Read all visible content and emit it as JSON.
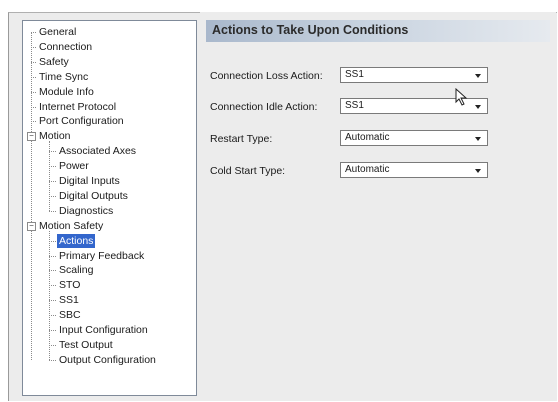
{
  "tree": {
    "items": [
      {
        "label": "General",
        "level": 0,
        "selected": false
      },
      {
        "label": "Connection",
        "level": 0,
        "selected": false
      },
      {
        "label": "Safety",
        "level": 0,
        "selected": false
      },
      {
        "label": "Time Sync",
        "level": 0,
        "selected": false
      },
      {
        "label": "Module Info",
        "level": 0,
        "selected": false
      },
      {
        "label": "Internet Protocol",
        "level": 0,
        "selected": false
      },
      {
        "label": "Port Configuration",
        "level": 0,
        "selected": false
      },
      {
        "label": "Motion",
        "level": 0,
        "selected": false,
        "expander": "−"
      },
      {
        "label": "Associated Axes",
        "level": 1,
        "selected": false
      },
      {
        "label": "Power",
        "level": 1,
        "selected": false
      },
      {
        "label": "Digital Inputs",
        "level": 1,
        "selected": false
      },
      {
        "label": "Digital Outputs",
        "level": 1,
        "selected": false
      },
      {
        "label": "Diagnostics",
        "level": 1,
        "selected": false
      },
      {
        "label": "Motion Safety",
        "level": 0,
        "selected": false,
        "expander": "−"
      },
      {
        "label": "Actions",
        "level": 1,
        "selected": true
      },
      {
        "label": "Primary Feedback",
        "level": 1,
        "selected": false
      },
      {
        "label": "Scaling",
        "level": 1,
        "selected": false
      },
      {
        "label": "STO",
        "level": 1,
        "selected": false
      },
      {
        "label": "SS1",
        "level": 1,
        "selected": false
      },
      {
        "label": "SBC",
        "level": 1,
        "selected": false
      },
      {
        "label": "Input Configuration",
        "level": 1,
        "selected": false
      },
      {
        "label": "Test Output",
        "level": 1,
        "selected": false
      },
      {
        "label": "Output Configuration",
        "level": 1,
        "selected": false
      }
    ]
  },
  "main": {
    "title": "Actions to Take Upon Conditions",
    "fields": [
      {
        "label": "Connection Loss Action:",
        "value": "SS1"
      },
      {
        "label": "Connection Idle Action:",
        "value": "SS1"
      },
      {
        "label": "Restart Type:",
        "value": "Automatic"
      },
      {
        "label": "Cold Start Type:",
        "value": "Automatic"
      }
    ]
  },
  "colors": {
    "selection": "#3366cc",
    "header_gradient_start": "#a9b8cc",
    "panel_bg": "#ececec"
  }
}
